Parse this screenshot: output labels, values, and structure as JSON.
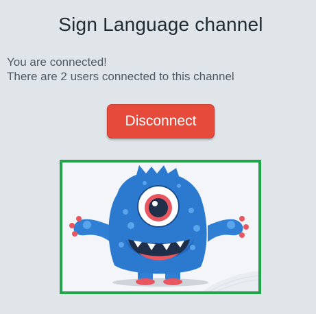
{
  "channel": {
    "title": "Sign Language channel"
  },
  "status": {
    "connected_text": "You are connected!",
    "users_text": "There are 2 users connected to this channel"
  },
  "controls": {
    "disconnect_label": "Disconnect"
  },
  "video": {
    "frame_color": "#21a44a",
    "content_icon": "blue-monster-avatar"
  },
  "colors": {
    "background": "#e0e5ea",
    "button": "#e64a3b",
    "title_text": "#1f2a33",
    "body_text": "#4d5963"
  }
}
